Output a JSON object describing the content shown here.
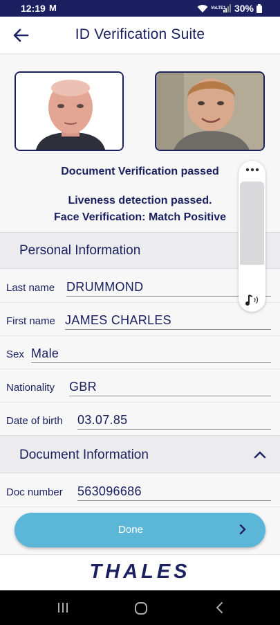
{
  "status_bar": {
    "time": "12:19",
    "notification": "M",
    "network": "VoLTE1",
    "battery": "30%"
  },
  "app_bar": {
    "title": "ID Verification Suite",
    "back_icon": "arrow-back-icon"
  },
  "verification": {
    "document_status": "Document Verification passed",
    "liveness_status": "Liveness detection passed.",
    "face_status": "Face Verification: Match Positive"
  },
  "sections": {
    "personal": "Personal Information",
    "document": "Document Information"
  },
  "personal": {
    "last_name": {
      "label": "Last name",
      "value": "DRUMMOND"
    },
    "first_name": {
      "label": "First name",
      "value": "JAMES CHARLES"
    },
    "sex": {
      "label": "Sex",
      "value": "Male"
    },
    "nationality": {
      "label": "Nationality",
      "value": "GBR"
    },
    "dob": {
      "label": "Date of birth",
      "value": "03.07.85"
    }
  },
  "document": {
    "doc_number": {
      "label": "Doc number",
      "value": "563096686"
    }
  },
  "actions": {
    "done": "Done"
  },
  "brand": {
    "logo": "THALES"
  },
  "colors": {
    "navy": "#1b2060",
    "button": "#5cb6d8"
  }
}
